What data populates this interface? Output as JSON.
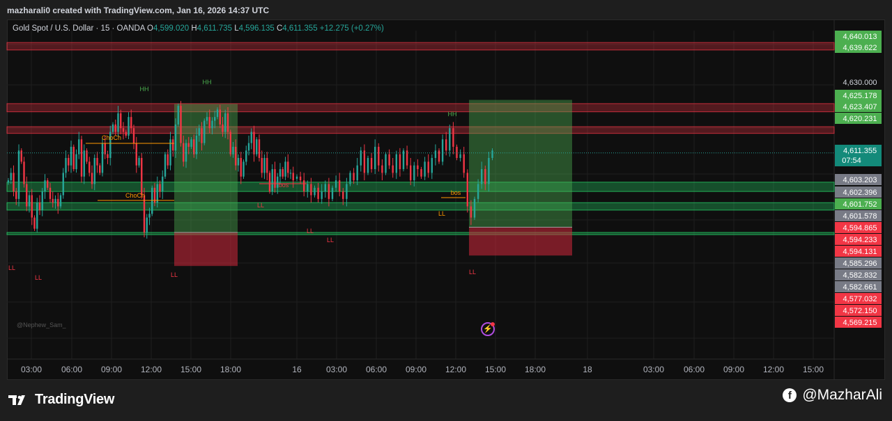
{
  "header": {
    "credit": "mazharali0 created with TradingView.com, Jan 16, 2026 14:37 UTC"
  },
  "legend": {
    "symbol": "Gold Spot / U.S. Dollar · 15 · OANDA",
    "o_label": "O",
    "o": "4,599.020",
    "h_label": "H",
    "h": "4,611.735",
    "l_label": "L",
    "l": "4,596.135",
    "c_label": "C",
    "c": "4,611.355",
    "change": "+12.275 (+0.27%)"
  },
  "watermark_user": "@Nephew_Sam_",
  "footer": {
    "brand": "TradingView",
    "handle": "@MazharAli",
    "brand_icon": "tradingview-logo-icon",
    "handle_icon": "facebook-icon"
  },
  "colors": {
    "up": "#26a69a",
    "down": "#f23645",
    "green_tag": "#4caf50",
    "red_tag": "#f23645",
    "grey_tag": "#787b86",
    "label_green": "#4caf50",
    "label_red": "#f23645",
    "label_orange": "#ff9800"
  },
  "chart_data": {
    "type": "candlestick",
    "title": "Gold Spot / U.S. Dollar · 15 · OANDA",
    "ylim": [
      4561.6,
      4644.2
    ],
    "x_tick_labels": [
      "03:00",
      "06:00",
      "09:00",
      "12:00",
      "15:00",
      "18:00",
      "16",
      "03:00",
      "06:00",
      "09:00",
      "12:00",
      "15:00",
      "18:00",
      "18",
      "03:00",
      "06:00",
      "09:00",
      "12:00",
      "15:00"
    ],
    "y_tick_labels": [
      "4,630.000"
    ],
    "current_price": {
      "value": "4,611.355",
      "countdown": "07:54"
    },
    "price_tags": [
      {
        "value": "4,640.013",
        "color": "green"
      },
      {
        "value": "4,639.622",
        "color": "green"
      },
      {
        "value": "4,625.178",
        "color": "green"
      },
      {
        "value": "4,623.407",
        "color": "green"
      },
      {
        "value": "4,620.231",
        "color": "green"
      },
      {
        "value": "4,603.203",
        "color": "grey"
      },
      {
        "value": "4,602.396",
        "color": "grey"
      },
      {
        "value": "4,601.752",
        "color": "green"
      },
      {
        "value": "4,601.578",
        "color": "grey"
      },
      {
        "value": "4,594.865",
        "color": "red"
      },
      {
        "value": "4,594.233",
        "color": "red"
      },
      {
        "value": "4,594.131",
        "color": "red"
      },
      {
        "value": "4,585.296",
        "color": "grey"
      },
      {
        "value": "4,582.832",
        "color": "grey"
      },
      {
        "value": "4,582.661",
        "color": "grey"
      },
      {
        "value": "4,577.032",
        "color": "red"
      },
      {
        "value": "4,572.150",
        "color": "red"
      },
      {
        "value": "4,569.215",
        "color": "red"
      }
    ],
    "zones": [
      {
        "kind": "supply",
        "from": 4639.0,
        "to": 4641.0
      },
      {
        "kind": "supply",
        "from": 4622.4,
        "to": 4624.6
      },
      {
        "kind": "supply",
        "from": 4616.6,
        "to": 4618.4
      },
      {
        "kind": "demand",
        "from": 4601.0,
        "to": 4603.5
      },
      {
        "kind": "demand",
        "from": 4596.0,
        "to": 4598.0
      },
      {
        "kind": "demand",
        "from": 4589.4,
        "to": 4590.0
      }
    ],
    "annotations": [
      {
        "text": "HH",
        "color": "green"
      },
      {
        "text": "HH",
        "color": "green"
      },
      {
        "text": "HH",
        "color": "green"
      },
      {
        "text": "ChoCh",
        "color": "orange"
      },
      {
        "text": "ChoCh",
        "color": "orange"
      },
      {
        "text": "bos",
        "color": "red"
      },
      {
        "text": "bos",
        "color": "orange"
      },
      {
        "text": "LL",
        "color": "red"
      },
      {
        "text": "LL",
        "color": "red"
      },
      {
        "text": "LL",
        "color": "red"
      },
      {
        "text": "LL",
        "color": "red"
      },
      {
        "text": "LL",
        "color": "red"
      },
      {
        "text": "LL",
        "color": "red"
      },
      {
        "text": "LL",
        "color": "orange"
      },
      {
        "text": "LL",
        "color": "red"
      }
    ],
    "positions": [
      {
        "side": "long",
        "entry": 4590.0,
        "target": 4624.5,
        "stop": 4581.0
      },
      {
        "side": "long",
        "entry": 4591.4,
        "target": 4625.6,
        "stop": 4583.8
      }
    ],
    "series": [
      {
        "name": "Gold Spot / U.S. Dollar",
        "segment": 1,
        "closes": [
          4604,
          4606,
          4601,
          4599,
          4612,
          4609,
          4603,
          4597,
          4600,
          4594,
          4591,
          4598,
          4596,
          4601,
          4604,
          4602,
          4599,
          4598,
          4599,
          4597,
          4600,
          4606,
          4610,
          4608,
          4613,
          4607,
          4611,
          4615,
          4605,
          4612,
          4609,
          4606,
          4603,
          4610,
          4608,
          4606,
          4614,
          4611,
          4610,
          4617,
          4619,
          4617,
          4622,
          4618,
          4617,
          4616,
          4621,
          4618,
          4614,
          4608,
          4610,
          4600,
          4590,
          4594,
          4595,
          4602,
          4598,
          4603,
          4601,
          4605,
          4611,
          4608,
          4615,
          4612,
          4619,
          4624,
          4614,
          4609,
          4614,
          4613,
          4615,
          4611,
          4616,
          4618,
          4614,
          4620,
          4621,
          4618,
          4620,
          4621,
          4623,
          4619,
          4617,
          4622,
          4617,
          4611,
          4613,
          4608,
          4610,
          4605,
          4609,
          4612,
          4614,
          4617,
          4611,
          4615,
          4610,
          4606,
          4610,
          4606,
          4601,
          4607,
          4602,
          4605,
          4607,
          4605,
          4609,
          4606,
          4606,
          4604
        ]
      },
      {
        "name": "Gold Spot / U.S. Dollar",
        "segment": 2,
        "closes": [
          4605,
          4604,
          4601,
          4603,
          4600,
          4602,
          4599,
          4601,
          4603,
          4599,
          4602,
          4604,
          4601,
          4599,
          4603,
          4606,
          4604,
          4608,
          4612,
          4606,
          4610,
          4607,
          4613,
          4608,
          4606,
          4611,
          4608,
          4606,
          4611,
          4607,
          4612,
          4608,
          4604,
          4608,
          4607,
          4605,
          4609,
          4606,
          4610,
          4612,
          4609,
          4615,
          4612,
          4618,
          4613,
          4610,
          4611,
          4606,
          4597,
          4594,
          4599,
          4603,
          4607,
          4603,
          4610,
          4612
        ]
      }
    ]
  }
}
